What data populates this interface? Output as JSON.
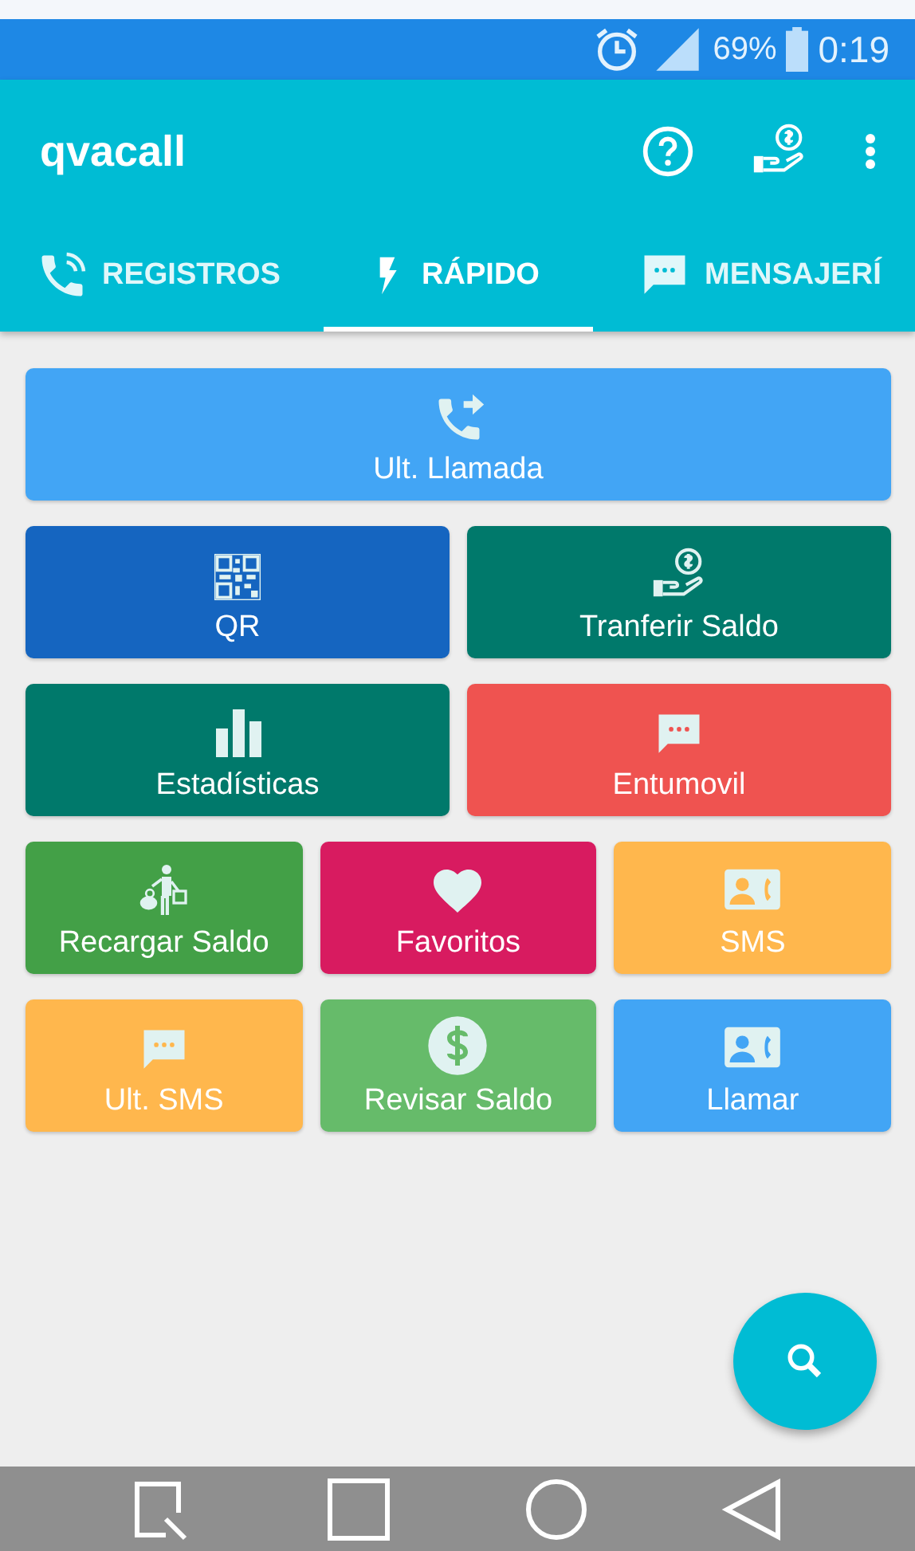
{
  "status_bar": {
    "battery": "69%",
    "time": "0:19"
  },
  "app_bar": {
    "title": "qvacall"
  },
  "tabs": [
    {
      "label": "REGISTROS",
      "kind": "phone",
      "selected": false
    },
    {
      "label": "RÁPIDO",
      "kind": "bolt",
      "selected": true
    },
    {
      "label": "MENSAJERÍ",
      "kind": "message",
      "selected": false
    }
  ],
  "rows": [
    {
      "tiles": [
        {
          "label": "Ult. Llamada",
          "kind": "forward",
          "color": "#42a5f5"
        }
      ]
    },
    {
      "tiles": [
        {
          "label": "QR",
          "kind": "qr",
          "color": "#1565c0"
        },
        {
          "label": "Tranferir Saldo",
          "kind": "transfer",
          "color": "#00796b"
        }
      ]
    },
    {
      "tiles": [
        {
          "label": "Estadísticas",
          "kind": "chart",
          "color": "#00796b"
        },
        {
          "label": "Entumovil",
          "kind": "message",
          "color": "#ef5350"
        }
      ]
    },
    {
      "tiles": [
        {
          "label": "Recargar Saldo",
          "kind": "person",
          "color": "#43a047"
        },
        {
          "label": "Favoritos",
          "kind": "heart",
          "color": "#d81b60"
        },
        {
          "label": "SMS",
          "kind": "contact",
          "color": "#ffb74d"
        }
      ]
    },
    {
      "tiles": [
        {
          "label": "Ult. SMS",
          "kind": "message",
          "color": "#ffb74d"
        },
        {
          "label": "Revisar Saldo",
          "kind": "dollar",
          "color": "#66bb6a"
        },
        {
          "label": "Llamar",
          "kind": "contact",
          "color": "#42a5f5"
        }
      ]
    }
  ]
}
